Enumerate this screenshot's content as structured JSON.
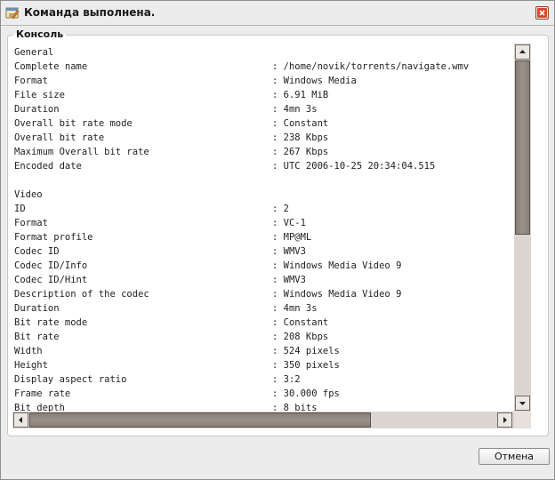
{
  "window": {
    "title": "Команда выполнена."
  },
  "group": {
    "legend": "Консоль"
  },
  "console": {
    "lines": [
      {
        "key": "General",
        "value": ""
      },
      {
        "key": "Complete name",
        "value": ": /home/novik/torrents/navigate.wmv"
      },
      {
        "key": "Format",
        "value": ": Windows Media"
      },
      {
        "key": "File size",
        "value": ": 6.91 MiB"
      },
      {
        "key": "Duration",
        "value": ": 4mn 3s"
      },
      {
        "key": "Overall bit rate mode",
        "value": ": Constant"
      },
      {
        "key": "Overall bit rate",
        "value": ": 238 Kbps"
      },
      {
        "key": "Maximum Overall bit rate",
        "value": ": 267 Kbps"
      },
      {
        "key": "Encoded date",
        "value": ": UTC 2006-10-25 20:34:04.515"
      },
      {
        "key": "",
        "value": ""
      },
      {
        "key": "Video",
        "value": ""
      },
      {
        "key": "ID",
        "value": ": 2"
      },
      {
        "key": "Format",
        "value": ": VC-1"
      },
      {
        "key": "Format profile",
        "value": ": MP@ML"
      },
      {
        "key": "Codec ID",
        "value": ": WMV3"
      },
      {
        "key": "Codec ID/Info",
        "value": ": Windows Media Video 9"
      },
      {
        "key": "Codec ID/Hint",
        "value": ": WMV3"
      },
      {
        "key": "Description of the codec",
        "value": ": Windows Media Video 9"
      },
      {
        "key": "Duration",
        "value": ": 4mn 3s"
      },
      {
        "key": "Bit rate mode",
        "value": ": Constant"
      },
      {
        "key": "Bit rate",
        "value": ": 208 Kbps"
      },
      {
        "key": "Width",
        "value": ": 524 pixels"
      },
      {
        "key": "Height",
        "value": ": 350 pixels"
      },
      {
        "key": "Display aspect ratio",
        "value": ": 3:2"
      },
      {
        "key": "Frame rate",
        "value": ": 30.000 fps"
      },
      {
        "key": "Bit depth",
        "value": ": 8 bits"
      }
    ]
  },
  "buttons": {
    "cancel": "Отмена"
  },
  "icons": {
    "app": "console-window-icon",
    "close": "close-icon",
    "up": "arrow-up-icon",
    "down": "arrow-down-icon",
    "left": "arrow-left-icon",
    "right": "arrow-right-icon"
  },
  "colors": {
    "close_accent": "#c8402a",
    "scrollbar_thumb": "#8a7f77",
    "scrollbar_track": "#dcd5cf"
  }
}
